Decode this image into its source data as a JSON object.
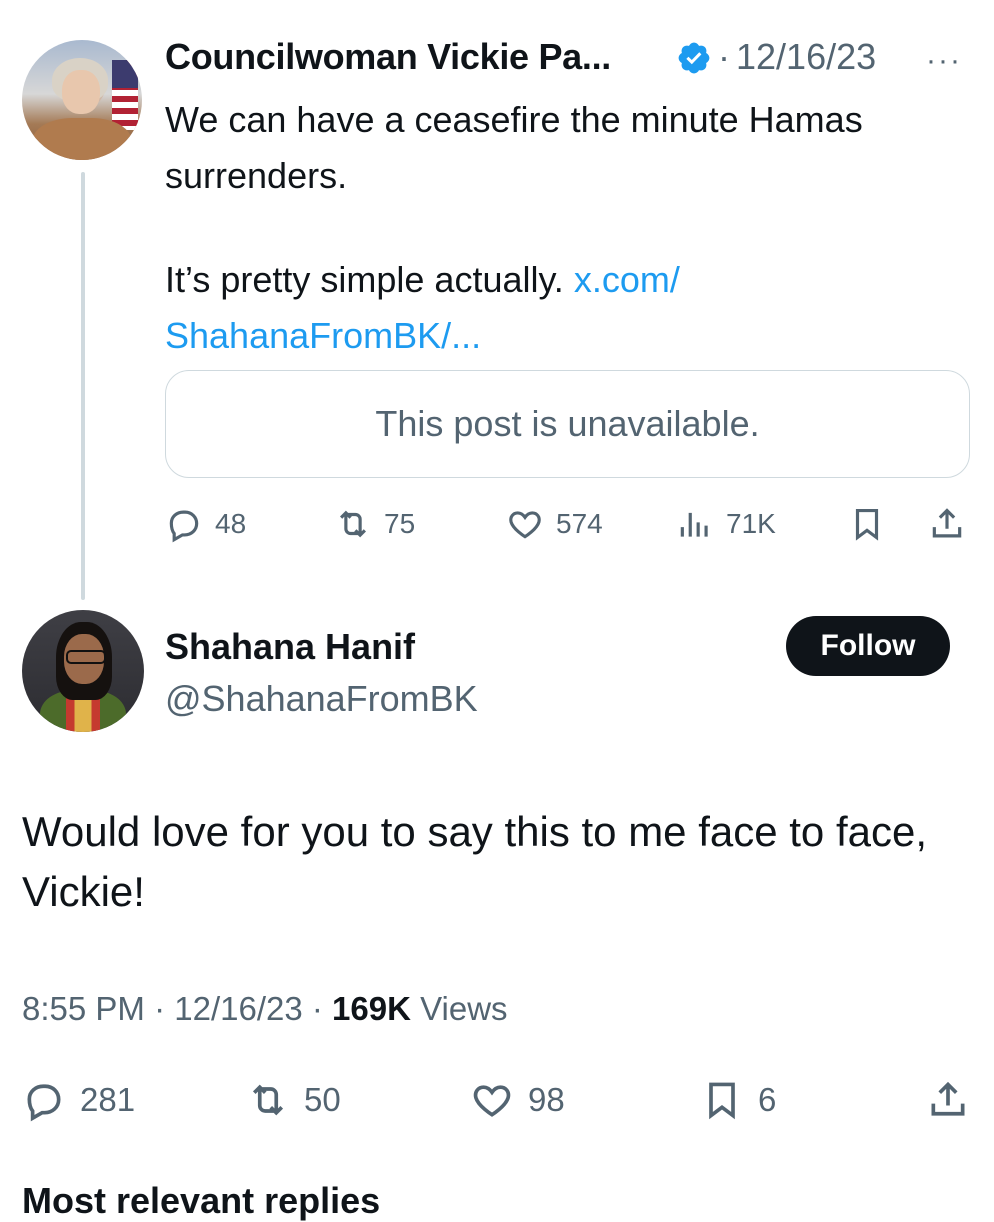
{
  "parent_tweet": {
    "author_name": "Councilwoman Vickie Pa...",
    "separator": "·",
    "date": "12/16/23",
    "more_icon": "···",
    "text_line1": "We can have a ceasefire the minute Hamas surrenders.",
    "text_line2_prefix": "It’s pretty simple actually. ",
    "link": "x.com/ ShahanaFromBK/...",
    "quoted_post_text": "This post is unavailable.",
    "stats": {
      "replies": "48",
      "reposts": "75",
      "likes": "574",
      "views": "71K"
    }
  },
  "main_tweet": {
    "author_name": "Shahana Hanif",
    "handle": "@ShahanaFromBK",
    "follow_label": "Follow",
    "text": "Would love for you to say this to me face to face, Vickie!",
    "time": "8:55 PM",
    "meta_sep1": " · ",
    "date": "12/16/23",
    "meta_sep2": " · ",
    "views_count": "169K",
    "views_label": " Views",
    "stats": {
      "replies": "281",
      "reposts": "50",
      "likes": "98",
      "bookmarks": "6"
    }
  },
  "bottom_partial_text": "Most relevant replies",
  "colors": {
    "text": "#0f1419",
    "secondary": "#536471",
    "link": "#1d9bf0",
    "border": "#cfd9de",
    "verified": "#1d9bf0"
  }
}
